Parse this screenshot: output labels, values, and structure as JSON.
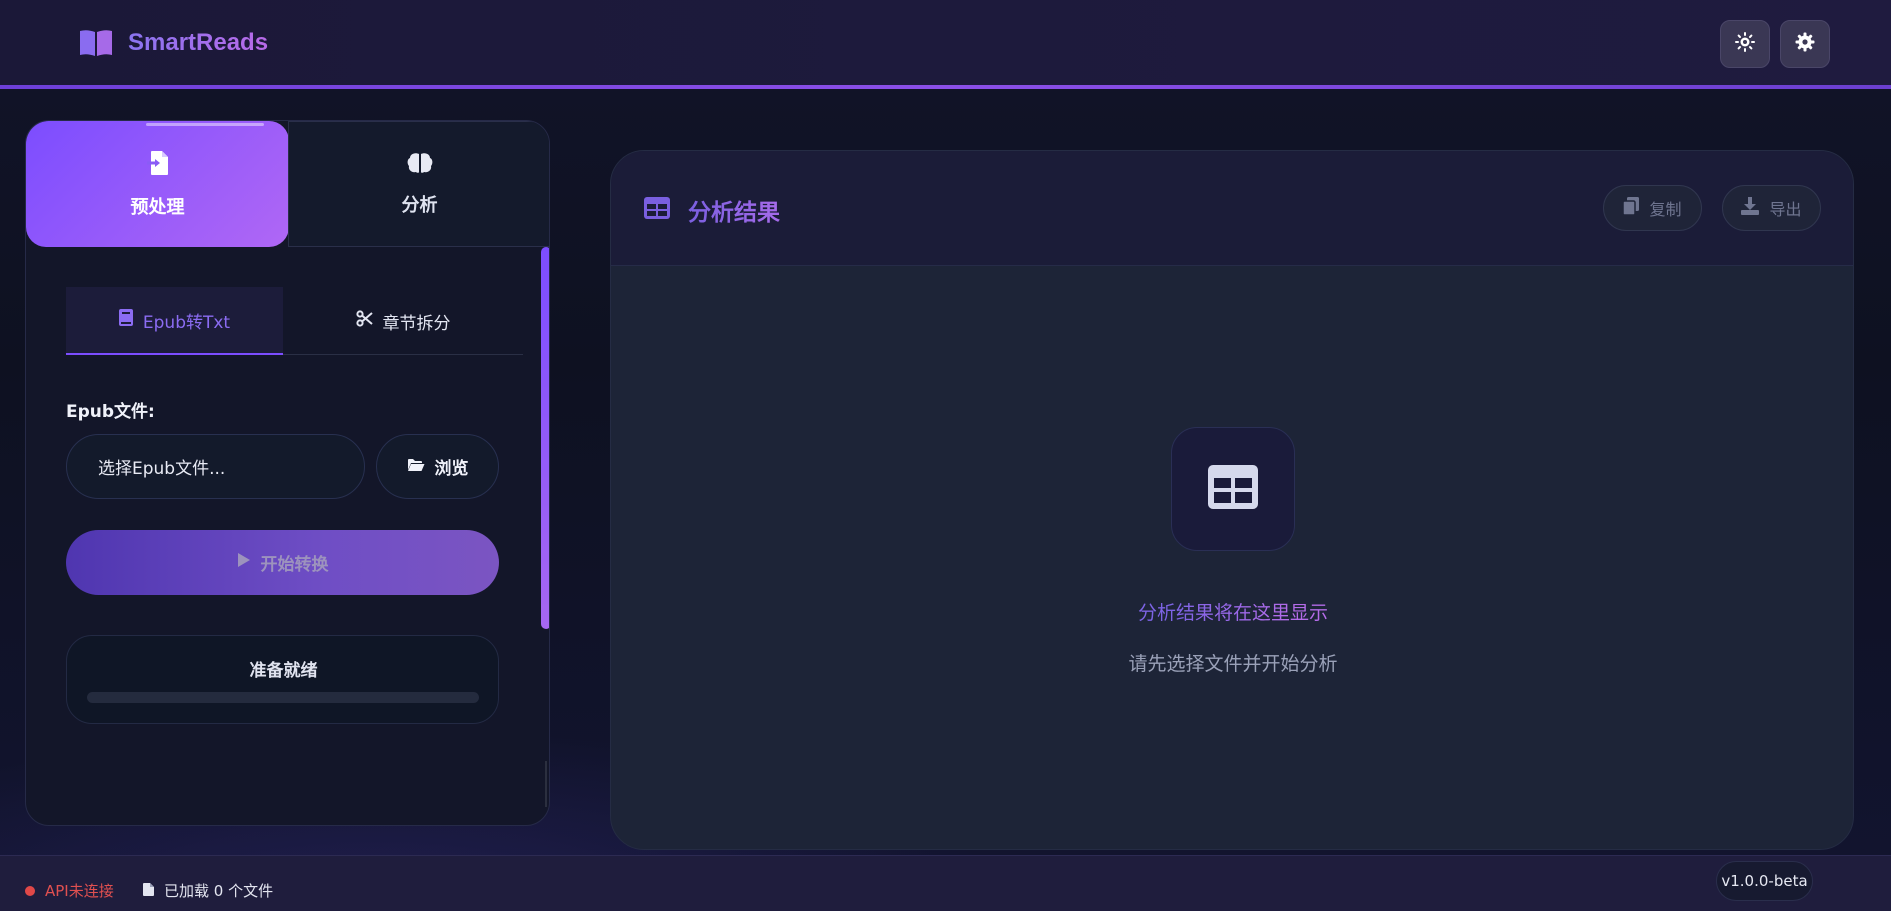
{
  "app": {
    "name": "SmartReads",
    "accent": "#7c4dff",
    "accent_secondary": "#b067f5"
  },
  "header": {
    "theme_button_icon": "sun-icon",
    "settings_button_icon": "gear-icon"
  },
  "mode_tabs": [
    {
      "label": "预处理",
      "icon": "file-import-icon",
      "active": true
    },
    {
      "label": "分析",
      "icon": "brain-icon",
      "active": false
    }
  ],
  "sub_tabs": [
    {
      "label": "Epub转Txt",
      "icon": "book-icon",
      "active": true
    },
    {
      "label": "章节拆分",
      "icon": "scissors-icon",
      "active": false
    }
  ],
  "epub_form": {
    "field_label": "Epub文件:",
    "file_input_value": "选择Epub文件...",
    "browse_label": "浏览",
    "start_label": "开始转换",
    "status_text": "准备就绪",
    "progress": 0
  },
  "results": {
    "title": "分析结果",
    "copy_label": "复制",
    "export_label": "导出",
    "empty_title": "分析结果将在这里显示",
    "empty_subtitle": "请先选择文件并开始分析"
  },
  "footer": {
    "api_status": "API未连接",
    "api_status_color": "#e04848",
    "files_loaded": "已加载 0 个文件",
    "version": "v1.0.0-beta"
  }
}
